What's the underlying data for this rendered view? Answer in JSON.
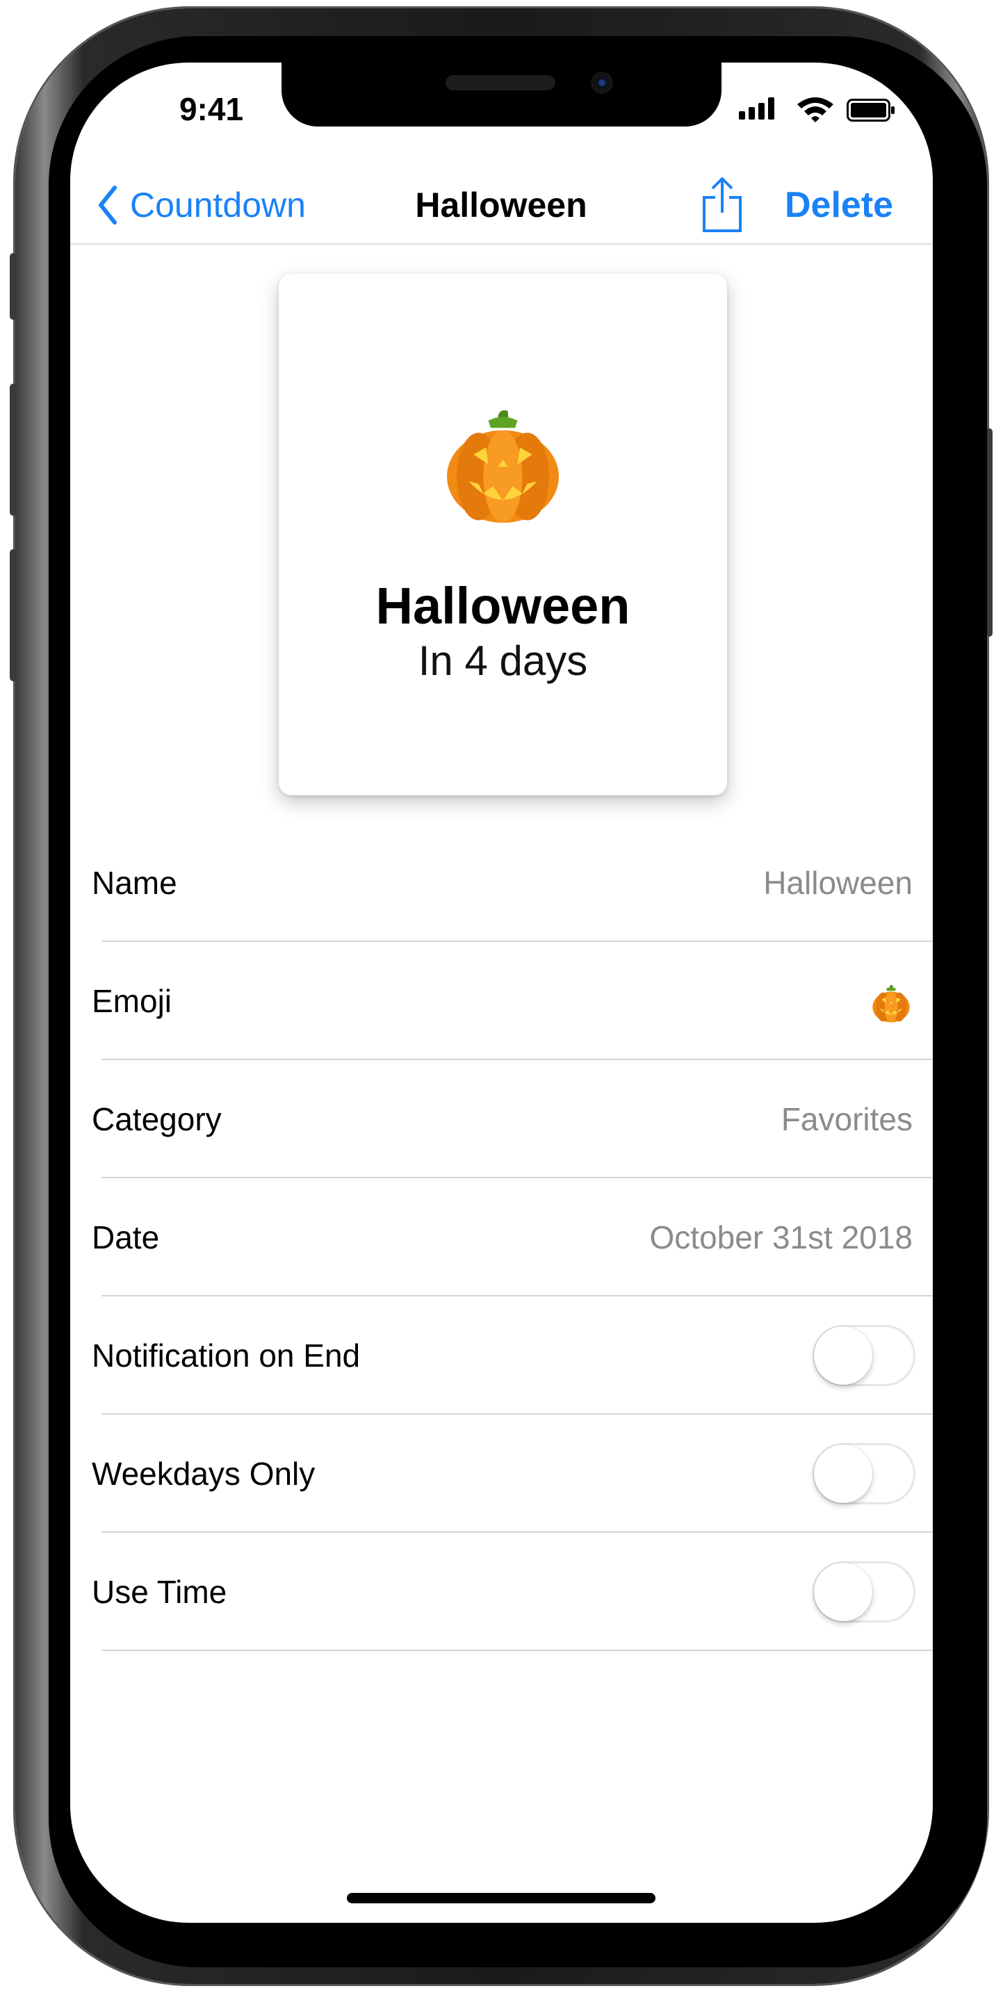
{
  "status_bar": {
    "time": "9:41"
  },
  "navbar": {
    "back_label": "Countdown",
    "title": "Halloween",
    "delete_label": "Delete"
  },
  "card": {
    "emoji_icon": "jack-o-lantern",
    "title": "Halloween",
    "subtitle": "In 4 days"
  },
  "rows": [
    {
      "label": "Name",
      "value": "Halloween"
    },
    {
      "label": "Emoji",
      "value_icon": "jack-o-lantern"
    },
    {
      "label": "Category",
      "value": "Favorites"
    },
    {
      "label": "Date",
      "value": "October 31st 2018"
    },
    {
      "label": "Notification on End",
      "toggle": false
    },
    {
      "label": "Weekdays Only",
      "toggle": false
    },
    {
      "label": "Use Time",
      "toggle": false
    }
  ],
  "colors": {
    "accent": "#1a82f7",
    "secondary_text": "#8a8a8f",
    "separator": "#d5d5d8",
    "pumpkin": "#f28a14"
  }
}
